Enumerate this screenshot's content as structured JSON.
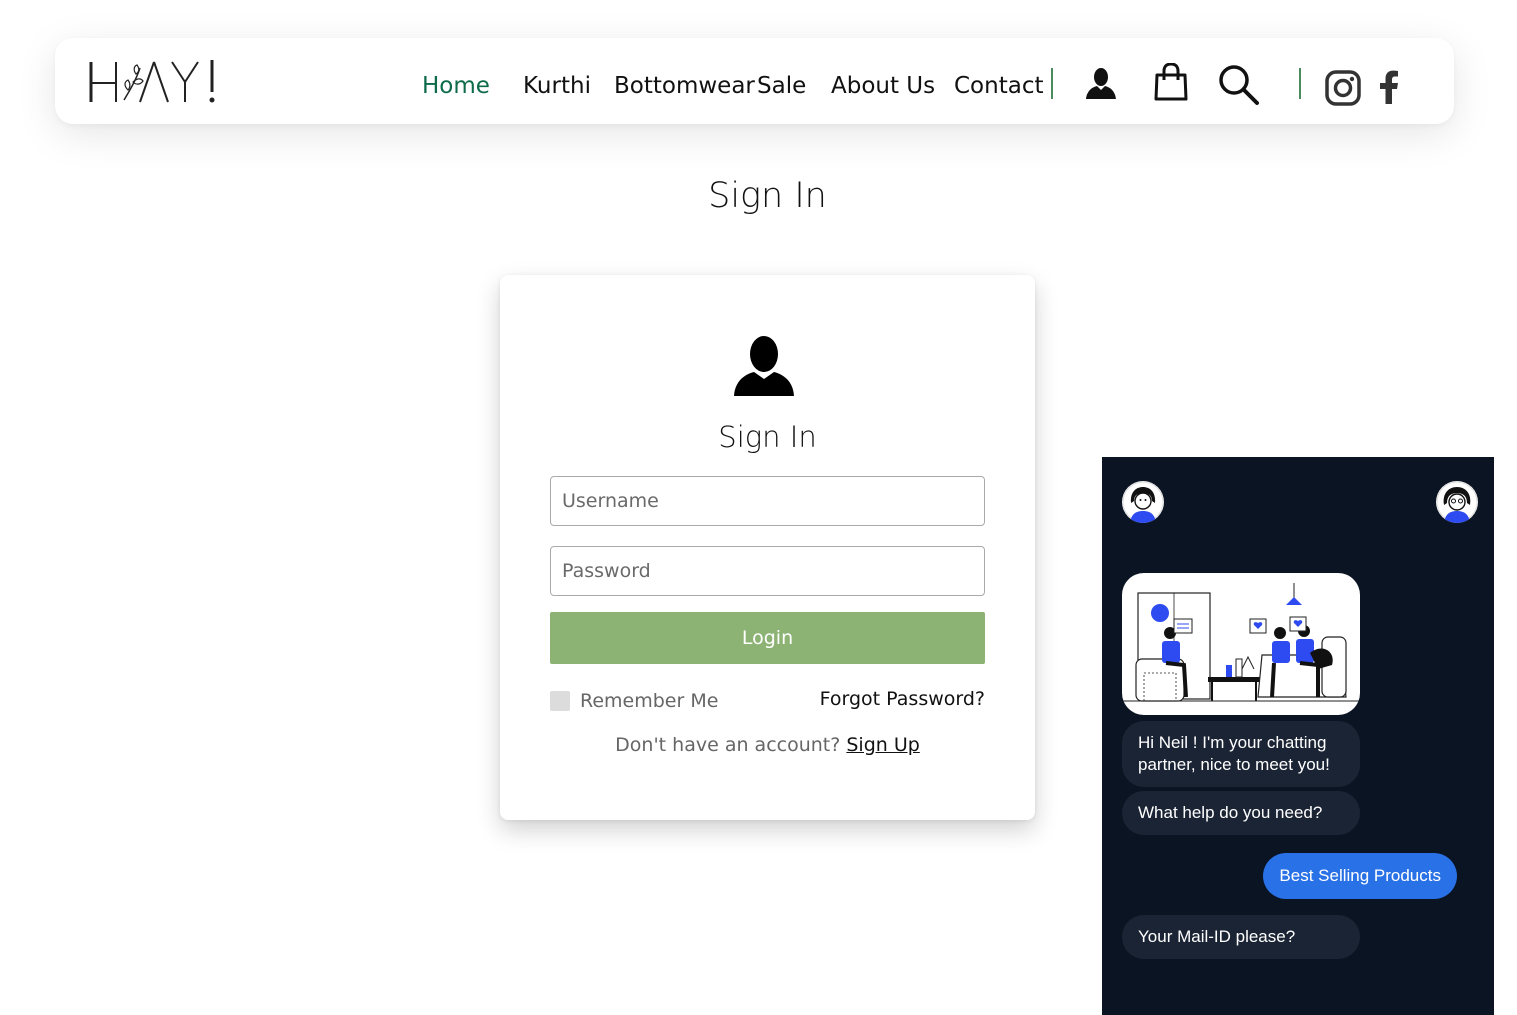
{
  "header": {
    "logo_text": "H AY!",
    "nav": [
      {
        "label": "Home",
        "active": true
      },
      {
        "label": "Kurthi"
      },
      {
        "label": "Bottomwear"
      },
      {
        "label": "Sale"
      },
      {
        "label": "About Us"
      },
      {
        "label": "Contact"
      }
    ],
    "icons": [
      "user-icon",
      "shopping-bag-icon",
      "search-icon",
      "instagram-icon",
      "facebook-icon"
    ]
  },
  "page": {
    "title": "Sign In"
  },
  "signin": {
    "title": "Sign In",
    "username_placeholder": "Username",
    "password_placeholder": "Password",
    "login_label": "Login",
    "remember_label": "Remember Me",
    "forgot_label": "Forgot Password?",
    "signup_prompt": "Don't have an account?",
    "signup_link": "Sign Up"
  },
  "chat": {
    "messages": [
      {
        "from": "bot",
        "text": "Hi Neil !  I'm your chatting partner, nice to meet you!"
      },
      {
        "from": "bot",
        "text": "What help do you need?"
      },
      {
        "from": "user",
        "text": "Best Selling Products"
      },
      {
        "from": "bot",
        "text": "Your Mail-ID please?"
      }
    ]
  },
  "colors": {
    "accent_green": "#0d6b4a",
    "login_button": "#8db374",
    "chat_background": "#0a1422",
    "chat_bot_bubble": "#1b2434",
    "chat_user_bubble": "#2871e6",
    "illustration_blue": "#2d4bf0"
  }
}
